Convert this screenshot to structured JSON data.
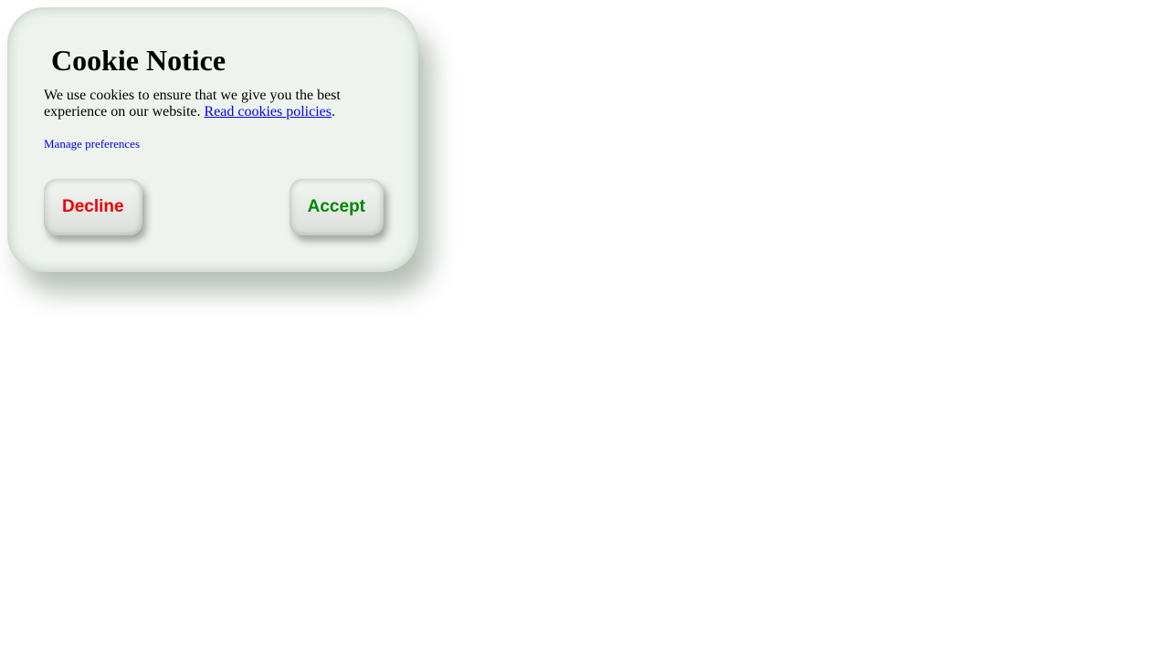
{
  "cookie_notice": {
    "icon": "cookie-icon",
    "icon_glyph": "",
    "title": "Cookie Notice",
    "message": "We use cookies to ensure that we give you the best experience on our website.",
    "policy_link": "Read cookies policies",
    "period": ".",
    "manage_link": "Manage preferences",
    "decline_label": "Decline",
    "accept_label": "Accept"
  },
  "colors": {
    "card_background": "#eef3ee",
    "decline": "#ee0000",
    "accept": "#008800",
    "link": "#0000ee"
  }
}
